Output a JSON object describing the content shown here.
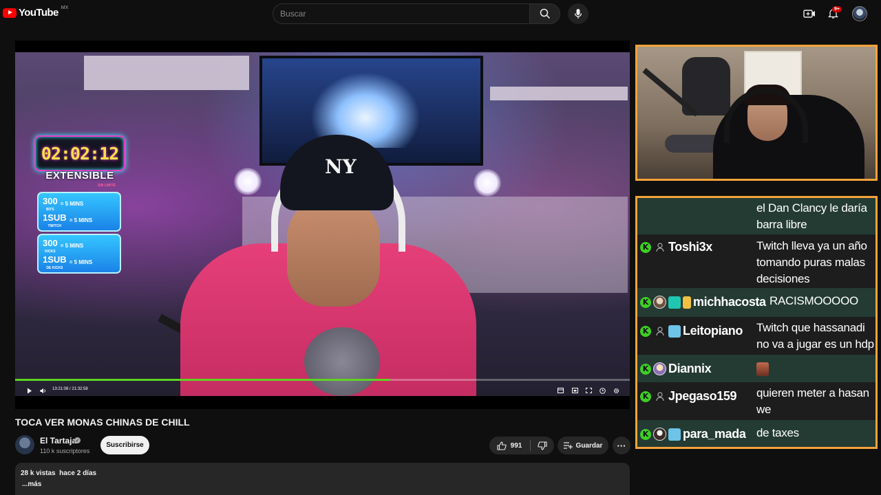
{
  "topbar": {
    "logo_text": "YouTube",
    "country_code": "MX",
    "search_placeholder": "Buscar",
    "notification_count": "9+"
  },
  "player": {
    "overlay": {
      "timer": "02:02:12",
      "extensible_label": "EXTENSIBLE",
      "sin_limite": "SIN LIMITE",
      "rates_twitch": [
        {
          "big": "300",
          "small": "BITS",
          "value": "= 5 MINS"
        },
        {
          "big": "1SUB",
          "small": "TWITCH",
          "value": "= 5 MINS"
        }
      ],
      "rates_kick": [
        {
          "big": "300",
          "small": "KICKS",
          "value": "= 5 MINS"
        },
        {
          "big": "1SUB",
          "small": "DE KICKS",
          "value": "= 5 MINS"
        }
      ],
      "cap_logo": "NY"
    },
    "progress_fraction": 0.61,
    "time_display": "13:21:08 / 21:32:58"
  },
  "chat": {
    "messages": [
      {
        "user": "",
        "text": "el Dan Clancy le daría barra libre",
        "has_badges": false
      },
      {
        "user": "Toshi3x",
        "text": "Twitch lleva ya un año tomando puras malas decisiones"
      },
      {
        "user": "michhacosta",
        "text": "RACISMOOOOO"
      },
      {
        "user": "Leitopiano",
        "text": "Twitch que hassanadi no va a jugar es un hdp"
      },
      {
        "user": "Diannix",
        "text": ""
      },
      {
        "user": "Jpegaso159",
        "text": "quieren meter a hasan we"
      },
      {
        "user": "para_mada",
        "text": "de taxes"
      }
    ],
    "badge_glyph": "K"
  },
  "video": {
    "title": "TOCA VER MONAS CHINAS DE CHILL",
    "channel_name": "El Tartaja",
    "subscribers": "110 k suscriptores",
    "subscribe_label": "Suscribirse",
    "like_count": "991",
    "save_label": "Guardar",
    "views_and_date": "28 k vistas  hace 2 días",
    "more_label": "...más"
  },
  "colors": {
    "progress": "#5fd31f",
    "frame_border": "#f5a43a",
    "chat_alt_row": "#243b34",
    "kick_badge": "#3ecf25"
  }
}
